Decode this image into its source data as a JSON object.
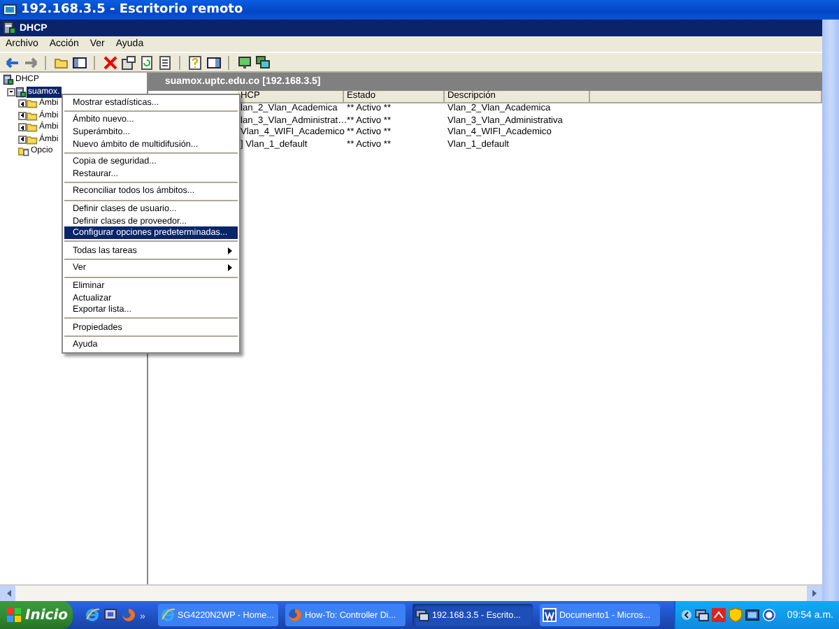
{
  "window": {
    "title": "192.168.3.5 - Escritorio remoto"
  },
  "console": {
    "title": "DHCP",
    "menu": [
      "Archivo",
      "Acción",
      "Ver",
      "Ayuda"
    ],
    "tree": [
      {
        "label": "DHCP",
        "selected": false,
        "children": [
          {
            "label": "suamox.",
            "selected": true,
            "expanded": true,
            "children": [
              {
                "label": "Ámbi",
                "selected": false,
                "expanded": false
              },
              {
                "label": "Ámbi",
                "selected": false,
                "expanded": false
              },
              {
                "label": "Ámbi",
                "selected": false,
                "expanded": false
              },
              {
                "label": "Ámbi",
                "selected": false,
                "expanded": false
              },
              {
                "label": "Opcio",
                "selected": false
              }
            ]
          }
        ]
      }
    ],
    "pane": {
      "title": "suamox.uptc.edu.co [192.168.3.5]",
      "columns": [
        "HCP",
        "Estado",
        "Descripción"
      ],
      "rows": [
        [
          "lan_2_Vlan_Academica",
          "** Activo **",
          "Vlan_2_Vlan_Academica"
        ],
        [
          "lan_3_Vlan_Administrat…",
          "** Activo **",
          "Vlan_3_Vlan_Administrativa"
        ],
        [
          "Vlan_4_WIFI_Academico",
          "** Activo **",
          "Vlan_4_WIFI_Academico"
        ],
        [
          "] Vlan_1_default",
          "** Activo **",
          "Vlan_1_default"
        ]
      ]
    },
    "context_menu": [
      {
        "kind": "item",
        "label": "Mostrar estadísticas...",
        "selected": false
      },
      {
        "kind": "separator"
      },
      {
        "kind": "item",
        "label": "Ámbito nuevo...",
        "selected": false
      },
      {
        "kind": "item",
        "label": "Superámbito...",
        "selected": false
      },
      {
        "kind": "item",
        "label": "Nuevo ámbito de multidifusión...",
        "selected": false
      },
      {
        "kind": "separator"
      },
      {
        "kind": "item",
        "label": "Copia de seguridad...",
        "selected": false
      },
      {
        "kind": "item",
        "label": "Restaurar...",
        "selected": false
      },
      {
        "kind": "separator"
      },
      {
        "kind": "item",
        "label": "Reconciliar todos los ámbitos...",
        "selected": false
      },
      {
        "kind": "separator"
      },
      {
        "kind": "item",
        "label": "Definir clases de usuario...",
        "selected": false
      },
      {
        "kind": "item",
        "label": "Definir clases de proveedor...",
        "selected": false
      },
      {
        "kind": "item",
        "label": "Configurar opciones predeterminadas...",
        "selected": true
      },
      {
        "kind": "separator"
      },
      {
        "kind": "submenu",
        "label": "Todas las tareas",
        "selected": false
      },
      {
        "kind": "separator"
      },
      {
        "kind": "submenu",
        "label": "Ver",
        "selected": false
      },
      {
        "kind": "separator"
      },
      {
        "kind": "item",
        "label": "Eliminar",
        "selected": false
      },
      {
        "kind": "item",
        "label": "Actualizar",
        "selected": false
      },
      {
        "kind": "item",
        "label": "Exportar lista...",
        "selected": false
      },
      {
        "kind": "separator"
      },
      {
        "kind": "item",
        "label": "Propiedades",
        "selected": false
      },
      {
        "kind": "separator"
      },
      {
        "kind": "item",
        "label": "Ayuda",
        "selected": false
      }
    ]
  },
  "taskbar": {
    "start": "Inicio",
    "more": "»",
    "tasks": [
      {
        "label": "SG4220N2WP - Home...",
        "selected": false
      },
      {
        "label": "How-To: Controller Di...",
        "selected": false
      },
      {
        "label": "192.168.3.5 - Escrito...",
        "selected": true
      },
      {
        "label": "Documento1 - Micros...",
        "selected": false
      }
    ],
    "clock": "09:54 a.m."
  }
}
